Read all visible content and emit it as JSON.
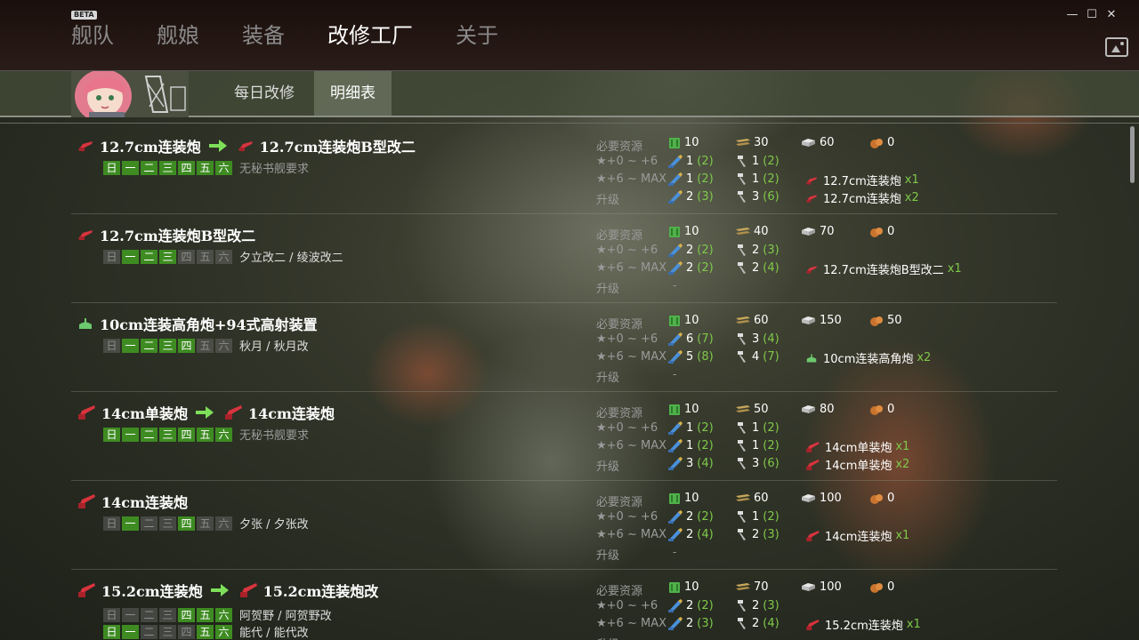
{
  "nav": {
    "beta": "BETA",
    "items": [
      {
        "label": "舰队",
        "active": false
      },
      {
        "label": "舰娘",
        "active": false
      },
      {
        "label": "装备",
        "active": false
      },
      {
        "label": "改修工厂",
        "active": true
      },
      {
        "label": "关于",
        "active": false
      }
    ]
  },
  "window": {
    "minimize": "—",
    "maximize": "☐",
    "close": "✕"
  },
  "subtabs": [
    {
      "label": "每日改修",
      "active": false
    },
    {
      "label": "明细表",
      "active": true
    }
  ],
  "labels": {
    "required": "必要资源",
    "stage1": "★+0 ~ +6",
    "stage2": "★+6 ~ MAX",
    "upgrade": "升级",
    "dash": "-"
  },
  "days_labels": [
    "日",
    "一",
    "二",
    "三",
    "四",
    "五",
    "六"
  ],
  "colors": {
    "day_on": "#3e8b22",
    "green_text": "#7fc94a",
    "gun_red": "#d8343e",
    "aa_green": "#6cc96e"
  },
  "rows": [
    {
      "icon": "small-gun-icon",
      "name": "12.7cm连装炮",
      "upgrade_to": "12.7cm连装炮B型改二",
      "upgrade_icon": "small-gun-icon",
      "day_rows": [
        {
          "days": [
            1,
            1,
            1,
            1,
            1,
            1,
            1
          ],
          "ships": "无秘书舰要求",
          "none": true
        }
      ],
      "resources": {
        "fuel": "10",
        "ammo": "30",
        "steel": "60",
        "bauxite": "0"
      },
      "stage1": {
        "devmat": "1",
        "devmat_sure": "(2)",
        "screw": "1",
        "screw_sure": "(2)"
      },
      "stage2": {
        "devmat": "1",
        "devmat_sure": "(2)",
        "screw": "1",
        "screw_sure": "(2)",
        "consume": "12.7cm连装炮",
        "consume_count": "x1",
        "consume_icon": "small-gun-icon"
      },
      "upgrade": {
        "devmat": "2",
        "devmat_sure": "(3)",
        "screw": "3",
        "screw_sure": "(6)",
        "consume": "12.7cm连装炮",
        "consume_count": "x2",
        "consume_icon": "small-gun-icon"
      }
    },
    {
      "icon": "small-gun-icon",
      "name": "12.7cm连装炮B型改二",
      "upgrade_to": null,
      "day_rows": [
        {
          "days": [
            0,
            1,
            1,
            1,
            0,
            0,
            0
          ],
          "ships": "夕立改二 / 绫波改二",
          "none": false
        }
      ],
      "resources": {
        "fuel": "10",
        "ammo": "40",
        "steel": "70",
        "bauxite": "0"
      },
      "stage1": {
        "devmat": "2",
        "devmat_sure": "(2)",
        "screw": "2",
        "screw_sure": "(3)"
      },
      "stage2": {
        "devmat": "2",
        "devmat_sure": "(2)",
        "screw": "2",
        "screw_sure": "(4)",
        "consume": "12.7cm连装炮B型改二",
        "consume_count": "x1",
        "consume_icon": "small-gun-icon"
      },
      "upgrade": null
    },
    {
      "icon": "aa-gun-icon",
      "name": "10cm连装高角炮+94式高射装置",
      "upgrade_to": null,
      "day_rows": [
        {
          "days": [
            0,
            1,
            1,
            1,
            1,
            0,
            0
          ],
          "ships": "秋月 / 秋月改",
          "none": false
        }
      ],
      "resources": {
        "fuel": "10",
        "ammo": "60",
        "steel": "150",
        "bauxite": "50"
      },
      "stage1": {
        "devmat": "6",
        "devmat_sure": "(7)",
        "screw": "3",
        "screw_sure": "(4)"
      },
      "stage2": {
        "devmat": "5",
        "devmat_sure": "(8)",
        "screw": "4",
        "screw_sure": "(7)",
        "consume": "10cm连装高角炮",
        "consume_count": "x2",
        "consume_icon": "aa-gun-icon"
      },
      "upgrade": null
    },
    {
      "icon": "medium-gun-icon",
      "name": "14cm单装炮",
      "upgrade_to": "14cm连装炮",
      "upgrade_icon": "medium-gun-icon",
      "day_rows": [
        {
          "days": [
            1,
            1,
            1,
            1,
            1,
            1,
            1
          ],
          "ships": "无秘书舰要求",
          "none": true
        }
      ],
      "resources": {
        "fuel": "10",
        "ammo": "50",
        "steel": "80",
        "bauxite": "0"
      },
      "stage1": {
        "devmat": "1",
        "devmat_sure": "(2)",
        "screw": "1",
        "screw_sure": "(2)"
      },
      "stage2": {
        "devmat": "1",
        "devmat_sure": "(2)",
        "screw": "1",
        "screw_sure": "(2)",
        "consume": "14cm单装炮",
        "consume_count": "x1",
        "consume_icon": "medium-gun-icon"
      },
      "upgrade": {
        "devmat": "3",
        "devmat_sure": "(4)",
        "screw": "3",
        "screw_sure": "(6)",
        "consume": "14cm单装炮",
        "consume_count": "x2",
        "consume_icon": "medium-gun-icon"
      }
    },
    {
      "icon": "medium-gun-icon",
      "name": "14cm连装炮",
      "upgrade_to": null,
      "day_rows": [
        {
          "days": [
            0,
            1,
            0,
            0,
            1,
            0,
            0
          ],
          "ships": "夕张 / 夕张改",
          "none": false
        }
      ],
      "resources": {
        "fuel": "10",
        "ammo": "60",
        "steel": "100",
        "bauxite": "0"
      },
      "stage1": {
        "devmat": "2",
        "devmat_sure": "(2)",
        "screw": "1",
        "screw_sure": "(2)"
      },
      "stage2": {
        "devmat": "2",
        "devmat_sure": "(4)",
        "screw": "2",
        "screw_sure": "(3)",
        "consume": "14cm连装炮",
        "consume_count": "x1",
        "consume_icon": "medium-gun-icon"
      },
      "upgrade": null
    },
    {
      "icon": "medium-gun-icon",
      "name": "15.2cm连装炮",
      "upgrade_to": "15.2cm连装炮改",
      "upgrade_icon": "medium-gun-icon",
      "day_rows": [
        {
          "days": [
            0,
            0,
            0,
            0,
            1,
            1,
            1
          ],
          "ships": "阿贺野 / 阿贺野改",
          "none": false
        },
        {
          "days": [
            1,
            1,
            0,
            0,
            0,
            1,
            1
          ],
          "ships": "能代 / 能代改",
          "none": false
        }
      ],
      "resources": {
        "fuel": "10",
        "ammo": "70",
        "steel": "100",
        "bauxite": "0"
      },
      "stage1": {
        "devmat": "2",
        "devmat_sure": "(2)",
        "screw": "2",
        "screw_sure": "(3)"
      },
      "stage2": {
        "devmat": "2",
        "devmat_sure": "(3)",
        "screw": "2",
        "screw_sure": "(4)",
        "consume": "15.2cm连装炮",
        "consume_count": "x1",
        "consume_icon": "medium-gun-icon"
      },
      "upgrade": null
    }
  ]
}
